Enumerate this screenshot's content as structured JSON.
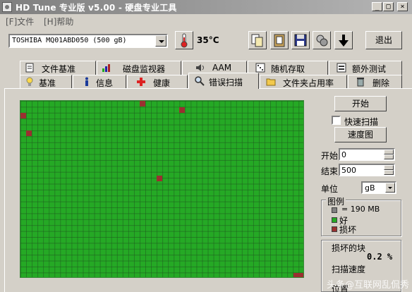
{
  "window": {
    "title": "HD Tune 专业版 v5.00 - 硬盘专业工具"
  },
  "menu": {
    "file": "[F]文件",
    "help": "[H]帮助"
  },
  "toolbar": {
    "drive": "TOSHIBA MQ01ABD050 (500 gB)",
    "temperature": "35°C",
    "exit_label": "退出"
  },
  "tabs_top": [
    "文件基准",
    "磁盘监视器",
    "AAM",
    "随机存取",
    "额外测试"
  ],
  "tabs_bottom": [
    "基准",
    "信息",
    "健康",
    "错误扫描",
    "文件夹占用率",
    "删除"
  ],
  "scan": {
    "start_label": "开始",
    "quick_scan_label": "快速扫描",
    "quick_scan_checked": false,
    "speed_map_label": "速度图",
    "start_field_label": "开始",
    "start_value": "0",
    "end_field_label": "结束",
    "end_value": "500",
    "unit_label": "单位",
    "unit_value": "gB"
  },
  "legend": {
    "title": "图例",
    "block_size": "= 190 MB",
    "good": "好",
    "bad": "损坏",
    "colors": {
      "block": "#808080",
      "good": "#25a925",
      "bad": "#9a3030"
    }
  },
  "stats": {
    "damaged_label": "损坏的块",
    "damaged_value": "0.2 %",
    "speed_label": "扫描速度",
    "position_label": "位置"
  },
  "watermark": "头条@互联网乱侃秀"
}
